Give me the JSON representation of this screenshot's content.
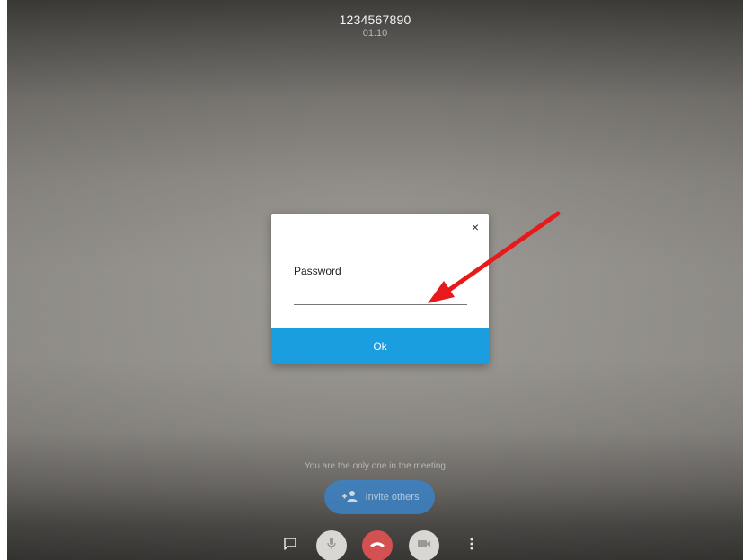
{
  "call": {
    "number": "1234567890",
    "duration": "01:10"
  },
  "dialog": {
    "close_glyph": "×",
    "password_label": "Password",
    "password_value": "",
    "ok_label": "Ok",
    "accent_color": "#1a9ee0"
  },
  "meeting": {
    "only_one_text": "You are the only one in the meeting",
    "invite_label": "Invite others"
  },
  "toolbar": {
    "buttons": [
      {
        "icon": "chat-icon"
      },
      {
        "icon": "microphone-icon"
      },
      {
        "icon": "hang-up-icon",
        "color": "#d45152"
      },
      {
        "icon": "video-camera-icon"
      },
      {
        "icon": "more-vertical-icon"
      }
    ]
  },
  "annotation": {
    "arrow_color": "#e8191b"
  }
}
